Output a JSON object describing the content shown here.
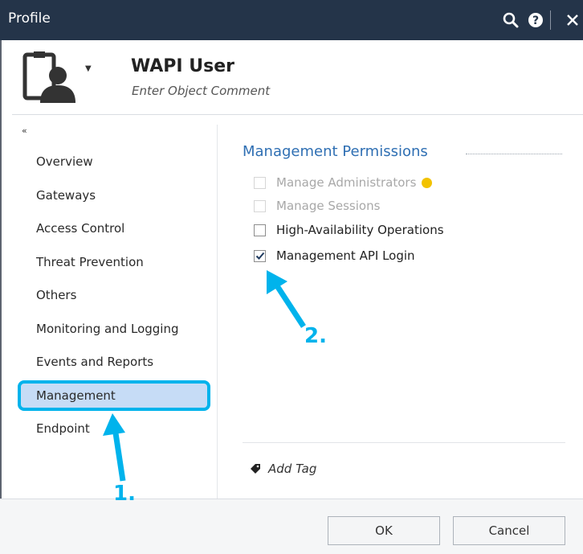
{
  "window": {
    "title": "Profile"
  },
  "header": {
    "object_name": "WAPI User",
    "comment_placeholder": "Enter Object Comment"
  },
  "sidebar": {
    "collapse_glyph": "«",
    "items": [
      {
        "label": "Overview"
      },
      {
        "label": "Gateways"
      },
      {
        "label": "Access Control"
      },
      {
        "label": "Threat Prevention"
      },
      {
        "label": "Others"
      },
      {
        "label": "Monitoring and Logging"
      },
      {
        "label": "Events and Reports"
      },
      {
        "label": "Management",
        "selected": true
      },
      {
        "label": "Endpoint"
      }
    ]
  },
  "main": {
    "section_title": "Management Permissions",
    "permissions": [
      {
        "label": "Manage Administrators",
        "checked": false,
        "enabled": false,
        "icon": "lightbulb-icon"
      },
      {
        "label": "Manage Sessions",
        "checked": false,
        "enabled": false
      },
      {
        "label": "High-Availability Operations",
        "checked": false,
        "enabled": true
      },
      {
        "label": "Management API Login",
        "checked": true,
        "enabled": true
      }
    ],
    "add_tag": "Add Tag"
  },
  "footer": {
    "ok_label": "OK",
    "cancel_label": "Cancel"
  },
  "annotations": {
    "step1": "1.",
    "step2": "2.",
    "color": "#00b3ec"
  },
  "colors": {
    "titlebar": "#243449",
    "accent": "#2f6fb3",
    "highlight": "#00b3ec",
    "selection": "#c6dcf6"
  }
}
